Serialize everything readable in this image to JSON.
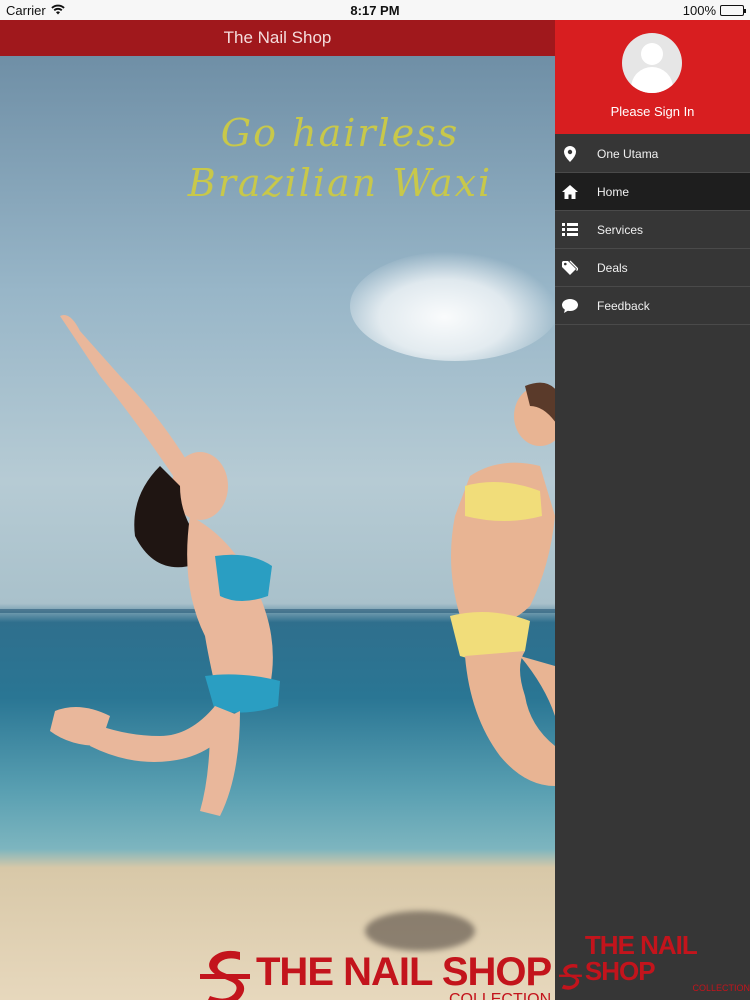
{
  "status_bar": {
    "carrier": "Carrier",
    "time": "8:17 PM",
    "battery": "100%"
  },
  "navbar": {
    "title": "The Nail Shop"
  },
  "hero": {
    "headline_line1": "Go hairless",
    "headline_line2": "Brazilian Waxi",
    "brand_name": "THE NAIL SHOP",
    "brand_sub": "COLLECTION"
  },
  "drawer": {
    "sign_in": "Please Sign In",
    "items": [
      {
        "label": "One Utama",
        "icon": "map-pin-icon"
      },
      {
        "label": "Home",
        "icon": "home-icon"
      },
      {
        "label": "Services",
        "icon": "list-icon"
      },
      {
        "label": "Deals",
        "icon": "tag-icon"
      },
      {
        "label": "Feedback",
        "icon": "chat-bubble-icon"
      }
    ],
    "selected_index": 1,
    "logo_name": "THE NAIL SHOP",
    "logo_sub": "COLLECTION"
  },
  "colors": {
    "navbar": "#a0181c",
    "drawer_header": "#d81e20",
    "drawer_bg": "#363636",
    "brand_red": "#c3141c",
    "headline": "#c8c84a"
  }
}
